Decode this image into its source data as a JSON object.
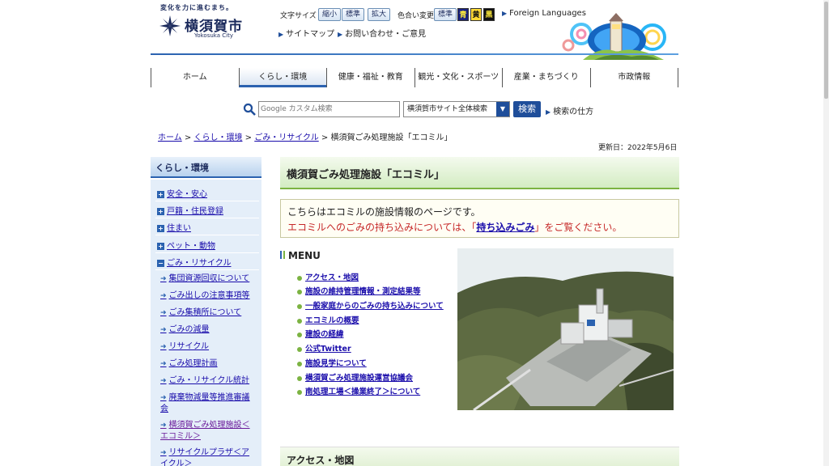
{
  "header": {
    "tagline": "変化を力に進むまち。",
    "city_name": "横須賀市",
    "city_name_en": "Yokosuka City",
    "font_size_label": "文字サイズ",
    "font_small": "縮小",
    "font_standard": "標準",
    "font_large": "拡大",
    "color_change_label": "色合い変更",
    "color_standard": "標準",
    "color_blue": "青",
    "color_yellow": "黄",
    "color_black": "黒",
    "foreign_languages": "Foreign Languages",
    "sitemap": "サイトマップ",
    "contact": "お問い合わせ・ご意見"
  },
  "gnav": [
    {
      "label": "ホーム"
    },
    {
      "label": "くらし・環境"
    },
    {
      "label": "健康・福祉・教育"
    },
    {
      "label": "観光・文化・スポーツ"
    },
    {
      "label": "産業・まちづくり"
    },
    {
      "label": "市政情報"
    }
  ],
  "search": {
    "placeholder": "Google カスタム検索",
    "scope": "横須賀市サイト全体検索",
    "button": "検索",
    "howto": "検索の仕方"
  },
  "breadcrumb": {
    "home": "ホーム",
    "l1": "くらし・環境",
    "l2": "ごみ・リサイクル",
    "current": "横須賀ごみ処理施設「エコミル」",
    "sep": ">"
  },
  "updated": "更新日：2022年5月6日",
  "sidebar": {
    "title": "くらし・環境",
    "categories": [
      {
        "label": "安全・安心"
      },
      {
        "label": "戸籍・住民登録"
      },
      {
        "label": "住まい"
      },
      {
        "label": "ペット・動物"
      },
      {
        "label": "ごみ・リサイクル"
      }
    ],
    "sub": [
      {
        "label": "集団資源回収について"
      },
      {
        "label": "ごみ出しの注意事項等"
      },
      {
        "label": "ごみ集積所について"
      },
      {
        "label": "ごみの減量"
      },
      {
        "label": "リサイクル"
      },
      {
        "label": "ごみ処理計画"
      },
      {
        "label": "ごみ・リサイクル統計"
      },
      {
        "label": "廃棄物減量等推進審議会"
      },
      {
        "label": "横須賀ごみ処理施設＜エコミル＞"
      },
      {
        "label": "リサイクルプラザ＜アイクル＞"
      }
    ]
  },
  "main": {
    "title": "横須賀ごみ処理施設「エコミル」",
    "notice_line1": "こちらはエコミルの施設情報のページです。",
    "notice_line2_pre": "エコミルへのごみの持ち込みについては、「",
    "notice_link": "持ち込みごみ",
    "notice_line2_post": "」をご覧ください。",
    "menu_title": "MENU",
    "menu": [
      {
        "label": "アクセス・地図"
      },
      {
        "label": "施設の維持管理情報・測定結果等"
      },
      {
        "label": "一般家庭からのごみの持ち込みについて"
      },
      {
        "label": "エコミルの概要"
      },
      {
        "label": "建設の経緯"
      },
      {
        "label": "公式Twitter"
      },
      {
        "label": "施設見学について"
      },
      {
        "label": "横須賀ごみ処理施設運営協議会"
      },
      {
        "label": "南処理工場＜操業終了＞について"
      }
    ],
    "section2_title": "アクセス・地図"
  },
  "colors": {
    "brand_blue": "#1f4e9a",
    "accent_green": "#7cb342",
    "notice_red": "#c62828"
  }
}
